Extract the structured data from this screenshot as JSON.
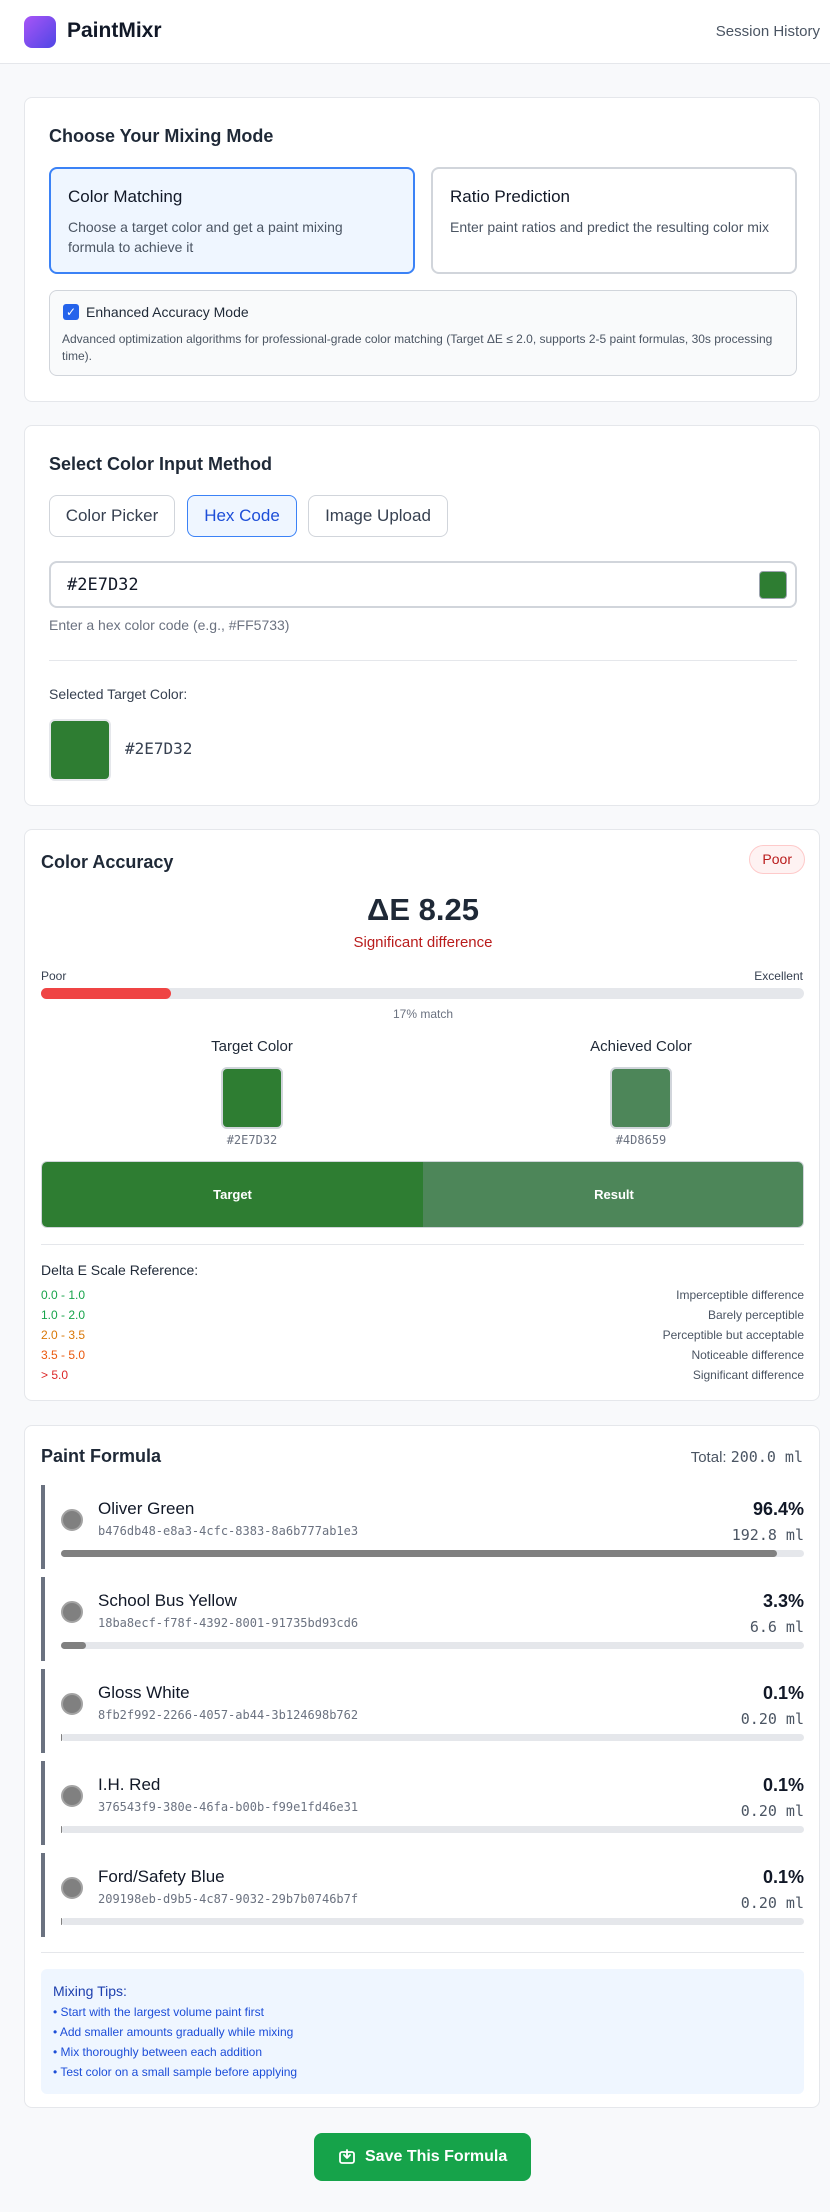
{
  "app": {
    "title": "PaintMixr",
    "nav_link": "Session History"
  },
  "mode_section": {
    "title": "Choose Your Mixing Mode",
    "modes": [
      {
        "title": "Color Matching",
        "description": "Choose a target color and get a paint mixing formula to achieve it",
        "selected": true
      },
      {
        "title": "Ratio Prediction",
        "description": "Enter paint ratios and predict the resulting color mix",
        "selected": false
      }
    ],
    "enhanced": {
      "label": "Enhanced Accuracy Mode",
      "checked": true,
      "description": "Advanced optimization algorithms for professional-grade color matching (Target ΔE ≤ 2.0, supports 2-5 paint formulas, 30s processing time)."
    }
  },
  "input_section": {
    "title": "Select Color Input Method",
    "tabs": [
      "Color Picker",
      "Hex Code",
      "Image Upload"
    ],
    "active_tab": "Hex Code",
    "hex_value": "#2E7D32",
    "hint": "Enter a hex color code (e.g., #FF5733)",
    "selected_label": "Selected Target Color:",
    "selected_hex": "#2E7D32"
  },
  "accuracy": {
    "title": "Color Accuracy",
    "badge": "Poor",
    "delta_e": "ΔE 8.25",
    "verdict": "Significant difference",
    "scale_left": "Poor",
    "scale_right": "Excellent",
    "match_fraction": 0.17,
    "match_text": "17% match",
    "target_label": "Target Color",
    "target_hex": "#2E7D32",
    "achieved_label": "Achieved Color",
    "achieved_hex": "#4D8659",
    "split_target": "Target",
    "split_result": "Result",
    "reference_title": "Delta E Scale Reference:",
    "reference": [
      {
        "range": "0.0 - 1.0",
        "desc": "Imperceptible difference",
        "color": "#16a34a"
      },
      {
        "range": "1.0 - 2.0",
        "desc": "Barely perceptible",
        "color": "#16a34a"
      },
      {
        "range": "2.0 - 3.5",
        "desc": "Perceptible but acceptable",
        "color": "#d97706"
      },
      {
        "range": "3.5 - 5.0",
        "desc": "Noticeable difference",
        "color": "#ea580c"
      },
      {
        "range": "> 5.0",
        "desc": "Significant difference",
        "color": "#dc2626"
      }
    ]
  },
  "formula": {
    "title": "Paint Formula",
    "total_label": "Total:",
    "total_value": "200.0 ml",
    "paints": [
      {
        "name": "Oliver Green",
        "id": "b476db48-e8a3-4cfc-8383-8a6b777ab1e3",
        "percent": "96.4%",
        "volume": "192.8 ml",
        "fraction": 0.964
      },
      {
        "name": "School Bus Yellow",
        "id": "18ba8ecf-f78f-4392-8001-91735bd93cd6",
        "percent": "3.3%",
        "volume": "6.6 ml",
        "fraction": 0.033
      },
      {
        "name": "Gloss White",
        "id": "8fb2f992-2266-4057-ab44-3b124698b762",
        "percent": "0.1%",
        "volume": "0.20 ml",
        "fraction": 0.001
      },
      {
        "name": "I.H. Red",
        "id": "376543f9-380e-46fa-b00b-f99e1fd46e31",
        "percent": "0.1%",
        "volume": "0.20 ml",
        "fraction": 0.001
      },
      {
        "name": "Ford/Safety Blue",
        "id": "209198eb-d9b5-4c87-9032-29b7b0746b7f",
        "percent": "0.1%",
        "volume": "0.20 ml",
        "fraction": 0.001
      }
    ],
    "tips_title": "Mixing Tips:",
    "tips": [
      "• Start with the largest volume paint first",
      "• Add smaller amounts gradually while mixing",
      "• Mix thoroughly between each addition",
      "• Test color on a small sample before applying"
    ],
    "save_label": "Save This Formula"
  }
}
